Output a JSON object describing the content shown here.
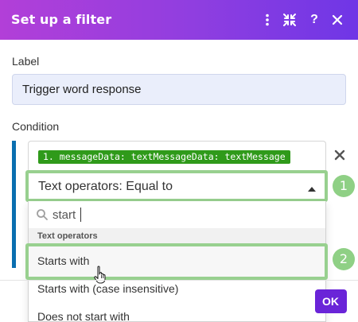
{
  "dialog": {
    "title": "Set up a filter",
    "header_icons": [
      "more-vertical-icon",
      "collapse-arrows-icon",
      "help-icon",
      "close-icon"
    ],
    "help_glyph": "?",
    "accent_gradient": [
      "#b23fd8",
      "#6f36e6"
    ]
  },
  "label_field": {
    "label": "Label",
    "value": "Trigger word response"
  },
  "condition": {
    "label": "Condition",
    "operand_token": "1. messageData: textMessageData: textMessage",
    "token_color": "#2f9a1a",
    "operator_select": {
      "selected": "Text operators: Equal to"
    },
    "dropdown": {
      "search_value": "start",
      "group_label": "Text operators",
      "options": [
        "Starts with",
        "Starts with (case insensitive)",
        "Does not start with"
      ]
    }
  },
  "annotations": {
    "badge_1": "1",
    "badge_2": "2",
    "highlight_color": "#98d08f"
  },
  "footer": {
    "ok_label": "OK"
  }
}
